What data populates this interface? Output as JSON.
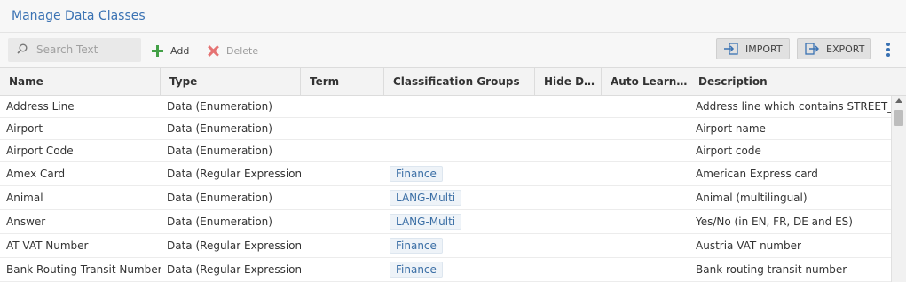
{
  "header": {
    "title": "Manage Data Classes"
  },
  "toolbar": {
    "search_placeholder": "Search Text",
    "add_label": "Add",
    "delete_label": "Delete",
    "import_label": "IMPORT",
    "export_label": "EXPORT"
  },
  "table": {
    "columns": [
      "Name",
      "Type",
      "Term",
      "Classification Groups",
      "Hide Data",
      "Auto Learni…",
      "Description"
    ],
    "rows": [
      {
        "name": "Address Line",
        "type": "Data (Enumeration)",
        "term": "",
        "group": "",
        "hide": "",
        "auto": "",
        "description": "Address line which contains STREET_TY"
      },
      {
        "name": "Airport",
        "type": "Data (Enumeration)",
        "term": "",
        "group": "",
        "hide": "",
        "auto": "",
        "description": "Airport name"
      },
      {
        "name": "Airport Code",
        "type": "Data (Enumeration)",
        "term": "",
        "group": "",
        "hide": "",
        "auto": "",
        "description": "Airport code"
      },
      {
        "name": "Amex Card",
        "type": "Data (Regular Expression)",
        "term": "",
        "group": "Finance",
        "hide": "",
        "auto": "",
        "description": "American Express card"
      },
      {
        "name": "Animal",
        "type": "Data (Enumeration)",
        "term": "",
        "group": "LANG-Multi",
        "hide": "",
        "auto": "",
        "description": "Animal (multilingual)"
      },
      {
        "name": "Answer",
        "type": "Data (Enumeration)",
        "term": "",
        "group": "LANG-Multi",
        "hide": "",
        "auto": "",
        "description": "Yes/No (in EN, FR, DE and ES)"
      },
      {
        "name": "AT VAT Number",
        "type": "Data (Regular Expression)",
        "term": "",
        "group": "Finance",
        "hide": "",
        "auto": "",
        "description": "Austria VAT number"
      },
      {
        "name": "Bank Routing Transit Number",
        "type": "Data (Regular Expression)",
        "term": "",
        "group": "Finance",
        "hide": "",
        "auto": "",
        "description": "Bank routing transit number"
      }
    ]
  }
}
